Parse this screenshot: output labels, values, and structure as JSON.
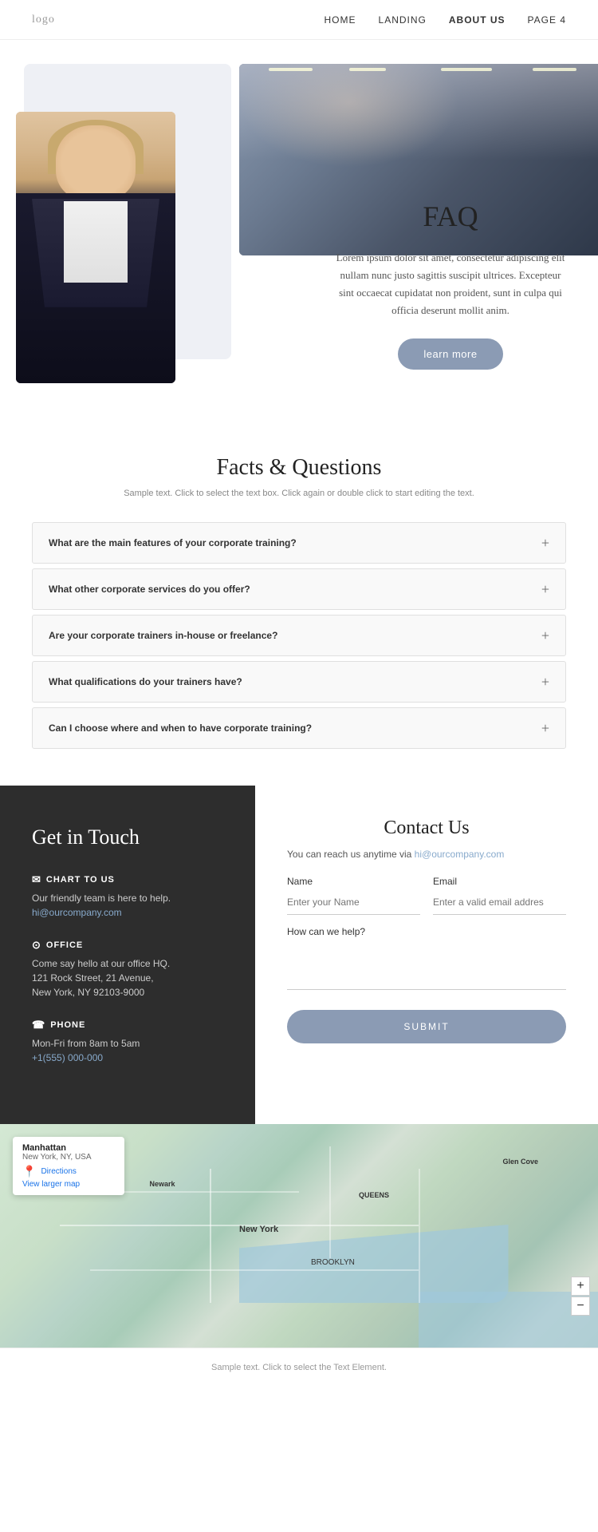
{
  "nav": {
    "logo": "logo",
    "links": [
      {
        "label": "HOME",
        "active": false
      },
      {
        "label": "LANDING",
        "active": false
      },
      {
        "label": "ABOUT US",
        "active": true
      },
      {
        "label": "PAGE 4",
        "active": false
      }
    ]
  },
  "hero": {
    "title": "FAQ",
    "description": "Lorem ipsum dolor sit amet, consectetur adipiscing elit nullam nunc justo sagittis suscipit ultrices. Excepteur sint occaecat cupidatat non proident, sunt in culpa qui officia deserunt mollit anim.",
    "button_label": "learn more"
  },
  "faq_section": {
    "title": "Facts & Questions",
    "subtitle": "Sample text. Click to select the text box. Click again or double click to start editing the text.",
    "items": [
      {
        "question": "What are the main features of your corporate training?"
      },
      {
        "question": "What other corporate services do you offer?"
      },
      {
        "question": "Are your corporate trainers in-house or freelance?"
      },
      {
        "question": "What qualifications do your trainers have?"
      },
      {
        "question": "Can I choose where and when to have corporate training?"
      }
    ]
  },
  "contact": {
    "left": {
      "title": "Get in Touch",
      "chart_label": "CHART TO US",
      "chart_desc": "Our friendly team is here to help.",
      "chart_email": "hi@ourcompany.com",
      "office_label": "OFFICE",
      "office_desc": "Come say hello at our office HQ.\n121 Rock Street, 21 Avenue,\nNew York, NY 92103-9000",
      "phone_label": "PHONE",
      "phone_desc": "Mon-Fri from 8am to 5am",
      "phone_number": "+1(555) 000-000"
    },
    "right": {
      "title": "Contact Us",
      "description": "You can reach us anytime via",
      "email_link": "hi@ourcompany.com",
      "name_label": "Name",
      "name_placeholder": "Enter your Name",
      "email_label": "Email",
      "email_placeholder": "Enter a valid email addres",
      "help_label": "How can we help?",
      "submit_label": "SUBMIT"
    }
  },
  "map": {
    "place": "Manhattan",
    "address": "New York, NY, USA",
    "directions": "Directions",
    "larger_map": "View larger map",
    "city_label": "New York"
  },
  "footer": {
    "text": "Sample text. Click to select the Text Element."
  }
}
